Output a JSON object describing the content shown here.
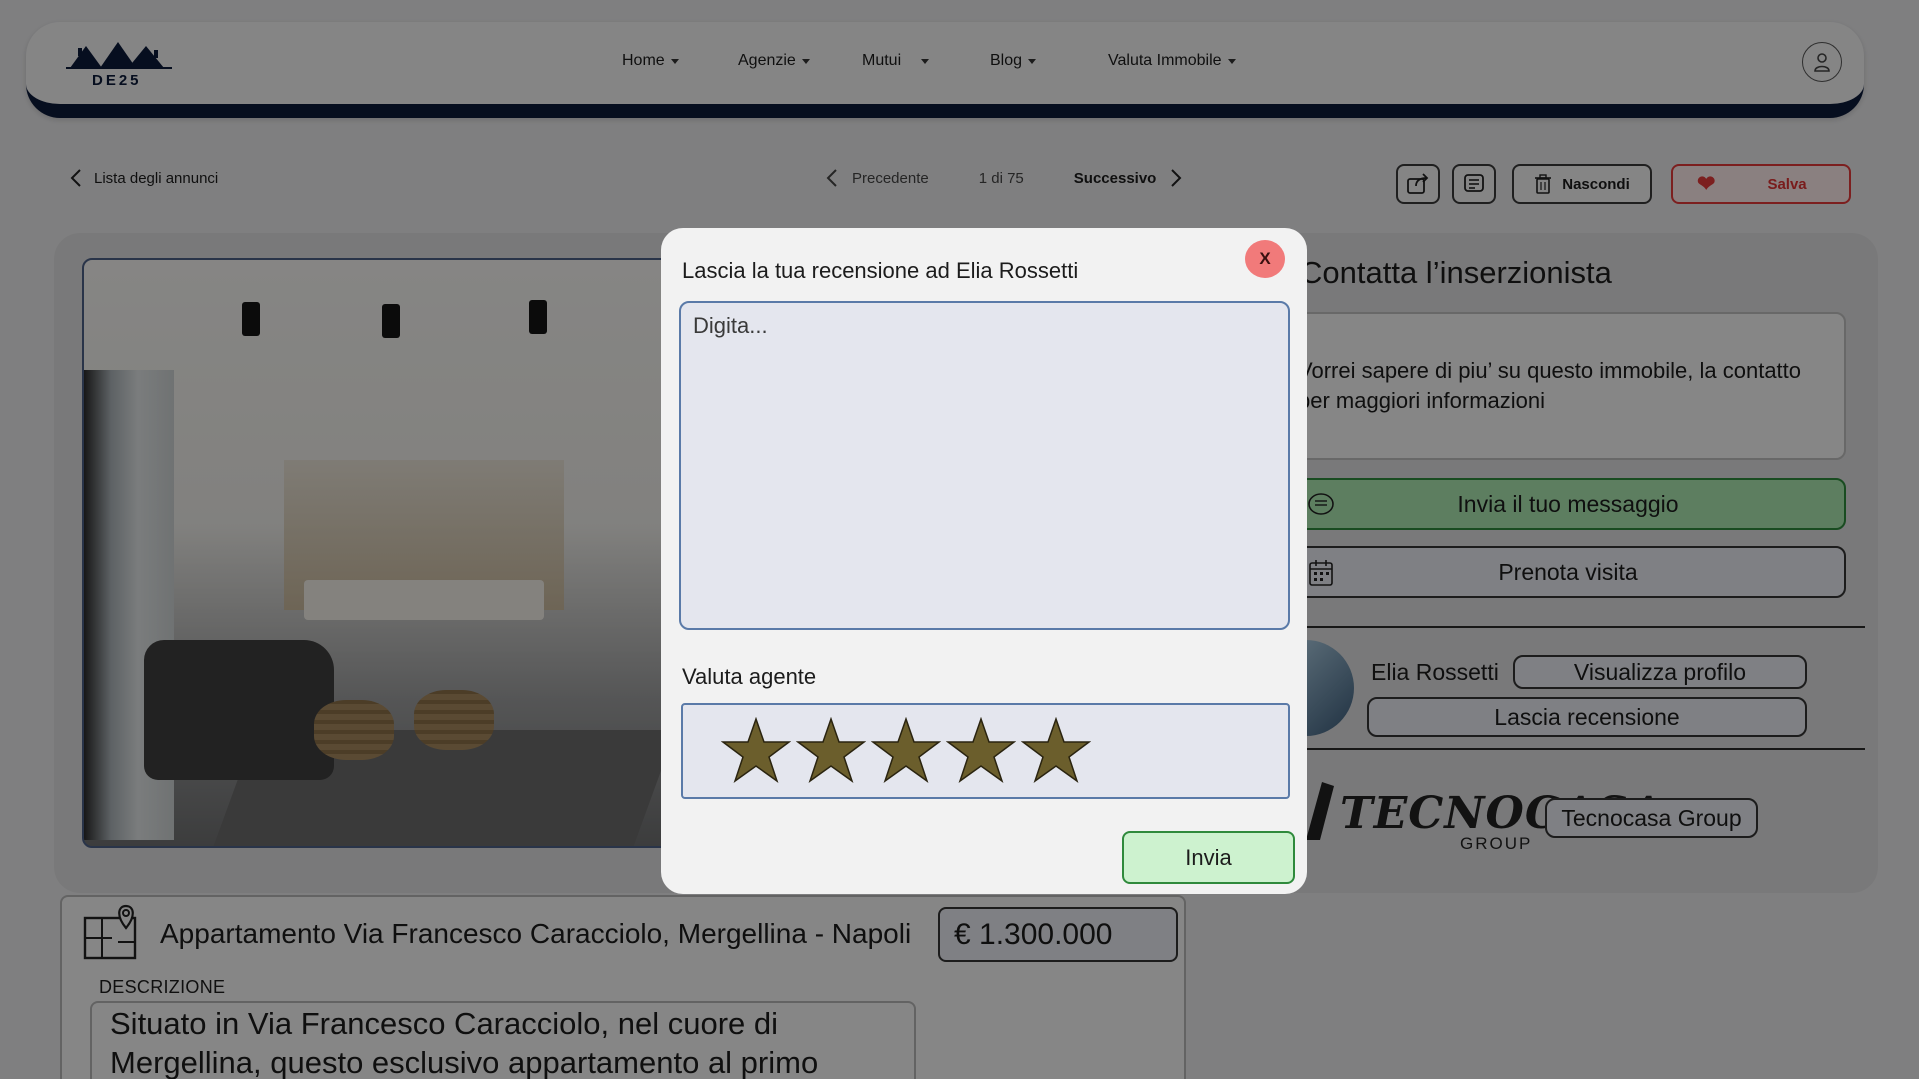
{
  "brand": {
    "logo_text": "DE25"
  },
  "nav": {
    "items": [
      {
        "label": "Home"
      },
      {
        "label": "Agenzie"
      },
      {
        "label": "Mutui"
      },
      {
        "label": "Blog"
      },
      {
        "label": "Valuta Immobile"
      }
    ]
  },
  "toolbar": {
    "back_label": "Lista degli annunci",
    "prev_label": "Precedente",
    "page_count": "1 di 75",
    "next_label": "Successivo",
    "hide_label": "Nascondi",
    "save_label": "Salva"
  },
  "contact": {
    "title": "Contatta l’inserzionista",
    "message": "Vorrei sapere di piu’ su questo immobile, la contatto per maggiori informazioni",
    "send_label": "Invia il tuo messaggio",
    "visit_label": "Prenota visita",
    "agent_name": "Elia Rossetti",
    "profile_label": "Visualizza profilo",
    "review_label": "Lascia recensione",
    "agency_logo_text": "TECNOCASA",
    "agency_logo_sub": "GROUP",
    "agency_label": "Tecnocasa Group"
  },
  "listing": {
    "title": "Appartamento Via Francesco Caracciolo, Mergellina - Napoli",
    "price": "€ 1.300.000",
    "description_label": "DESCRIZIONE",
    "description": "Situato in Via Francesco Caracciolo, nel cuore di Mergellina, questo esclusivo appartamento al primo"
  },
  "modal": {
    "title": "Lascia la tua recensione ad Elia Rossetti",
    "close_label": "X",
    "input_placeholder": "Digita...",
    "rating_label": "Valuta agente",
    "rating_value": 5,
    "rating_max": 5,
    "submit_label": "Invia"
  },
  "colors": {
    "navy": "#0c1a3a",
    "save_red": "#e23a3a",
    "send_green": "#a9e6b0",
    "star_fill": "#6b5e2c",
    "close_red": "#f17a7a"
  },
  "icons": [
    "user-icon",
    "chevron-left-icon",
    "chevron-right-icon",
    "share-icon",
    "note-icon",
    "trash-icon",
    "heart-icon",
    "chat-icon",
    "calendar-icon",
    "map-icon",
    "star-icon"
  ]
}
